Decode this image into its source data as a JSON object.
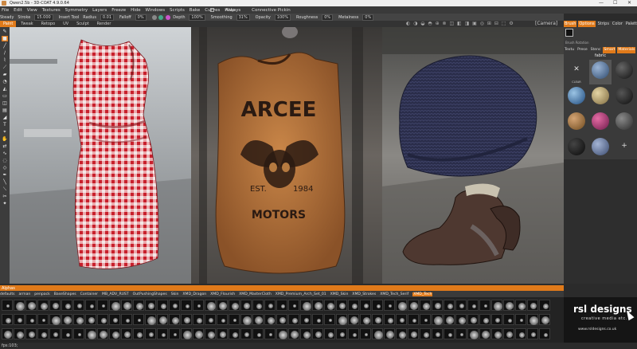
{
  "window": {
    "title": "Qwen2.5b - 3D-COAT 4.9.0.64",
    "controls": [
      "—",
      "☐",
      "✕"
    ]
  },
  "menu": {
    "items": [
      "File",
      "Edit",
      "View",
      "Textures",
      "Symmetry",
      "Layers",
      "Freeze",
      "Hide",
      "Windows",
      "Scripts",
      "Bake",
      "Curves",
      "Help"
    ],
    "always_label": "Always",
    "pick_label": "Connective Pickin"
  },
  "brush": {
    "mode": "Steady",
    "stroke_label": "Stroke",
    "stroke_value": "15.000",
    "insert_tool": "Insert Tool",
    "radius_label": "Radius",
    "radius_value": "0.01",
    "falloff_label": "Falloff",
    "falloff_value": "0%",
    "depth_label": "Depth",
    "depth_value": "100%",
    "smoothing_label": "Smoothing",
    "smoothing_value": "31%",
    "opacity_label": "Opacity",
    "opacity_value": "100%",
    "roughness_label": "Roughness",
    "roughness_value": "0%",
    "metalness_label": "Metalness",
    "metalness_value": "0%"
  },
  "rooms": {
    "tabs": [
      "Paint",
      "Tweak",
      "Retopo",
      "UV",
      "Sculpt",
      "Render"
    ],
    "active": "Paint",
    "camera": "[Camera]"
  },
  "right_panel": {
    "tabs": [
      "Brush",
      "Options",
      "Strips",
      "Color",
      "Palette"
    ],
    "active_tab": "Brush",
    "sub_row": "Brush Rotation",
    "tabs2": [
      "Textu",
      "Prese",
      "Stenc",
      "Smart",
      "Materials"
    ],
    "active_tab2": "Smart",
    "folder": "fabric",
    "clear_label": "CLEAR",
    "add_glyph": "+"
  },
  "alphas": {
    "header": "Alphas",
    "categories": [
      "defaults",
      "arman",
      "penpack",
      "BaseShapes",
      "Container",
      "MB_ADV_RUST",
      "OutPushingShapes",
      "Skin",
      "XMD_Dragon",
      "XMD_Flourish",
      "XMD_MasterCloth",
      "XMD_Premium_Arch_Set_01",
      "XMD_Skin",
      "XMD_Strokes",
      "XMD_Tech_Serif",
      "XMD_Tech"
    ],
    "active": "XMD_Tech"
  },
  "logo": {
    "name": "rsl designs",
    "tagline": "creative media etc.",
    "url": "www.rsldesigns.co.uk"
  },
  "status": {
    "fps": "fps:103;"
  },
  "viewport": {
    "vest_title": "ARCEE",
    "vest_est": "EST.",
    "vest_year": "1984",
    "vest_sub": "MOTORS"
  }
}
